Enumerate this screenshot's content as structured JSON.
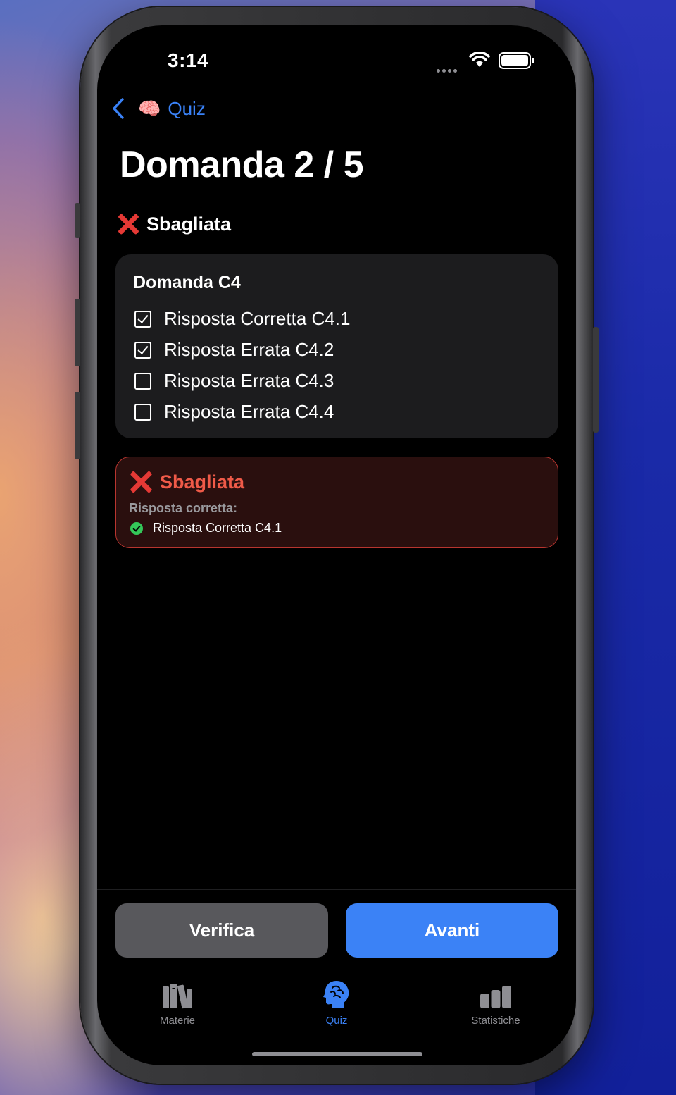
{
  "status_bar": {
    "time": "3:14"
  },
  "nav": {
    "back_emoji": "🧠",
    "back_label": "Quiz"
  },
  "page": {
    "title": "Domanda 2 / 5",
    "status_label": "Sbagliata"
  },
  "question": {
    "title": "Domanda C4",
    "options": [
      {
        "label": "Risposta Corretta C4.1",
        "checked": true
      },
      {
        "label": "Risposta Errata C4.2",
        "checked": true
      },
      {
        "label": "Risposta Errata C4.3",
        "checked": false
      },
      {
        "label": "Risposta Errata C4.4",
        "checked": false
      }
    ]
  },
  "result": {
    "heading": "Sbagliata",
    "subtitle": "Risposta corretta:",
    "correct_answer": "Risposta Corretta C4.1"
  },
  "actions": {
    "verify_label": "Verifica",
    "next_label": "Avanti"
  },
  "tabs": [
    {
      "label": "Materie",
      "icon": "books-icon"
    },
    {
      "label": "Quiz",
      "icon": "brain-head-icon",
      "active": true
    },
    {
      "label": "Statistiche",
      "icon": "bar-chart-icon"
    }
  ],
  "colors": {
    "accent": "#3b82f6",
    "error": "#e53935",
    "success": "#34c759"
  }
}
